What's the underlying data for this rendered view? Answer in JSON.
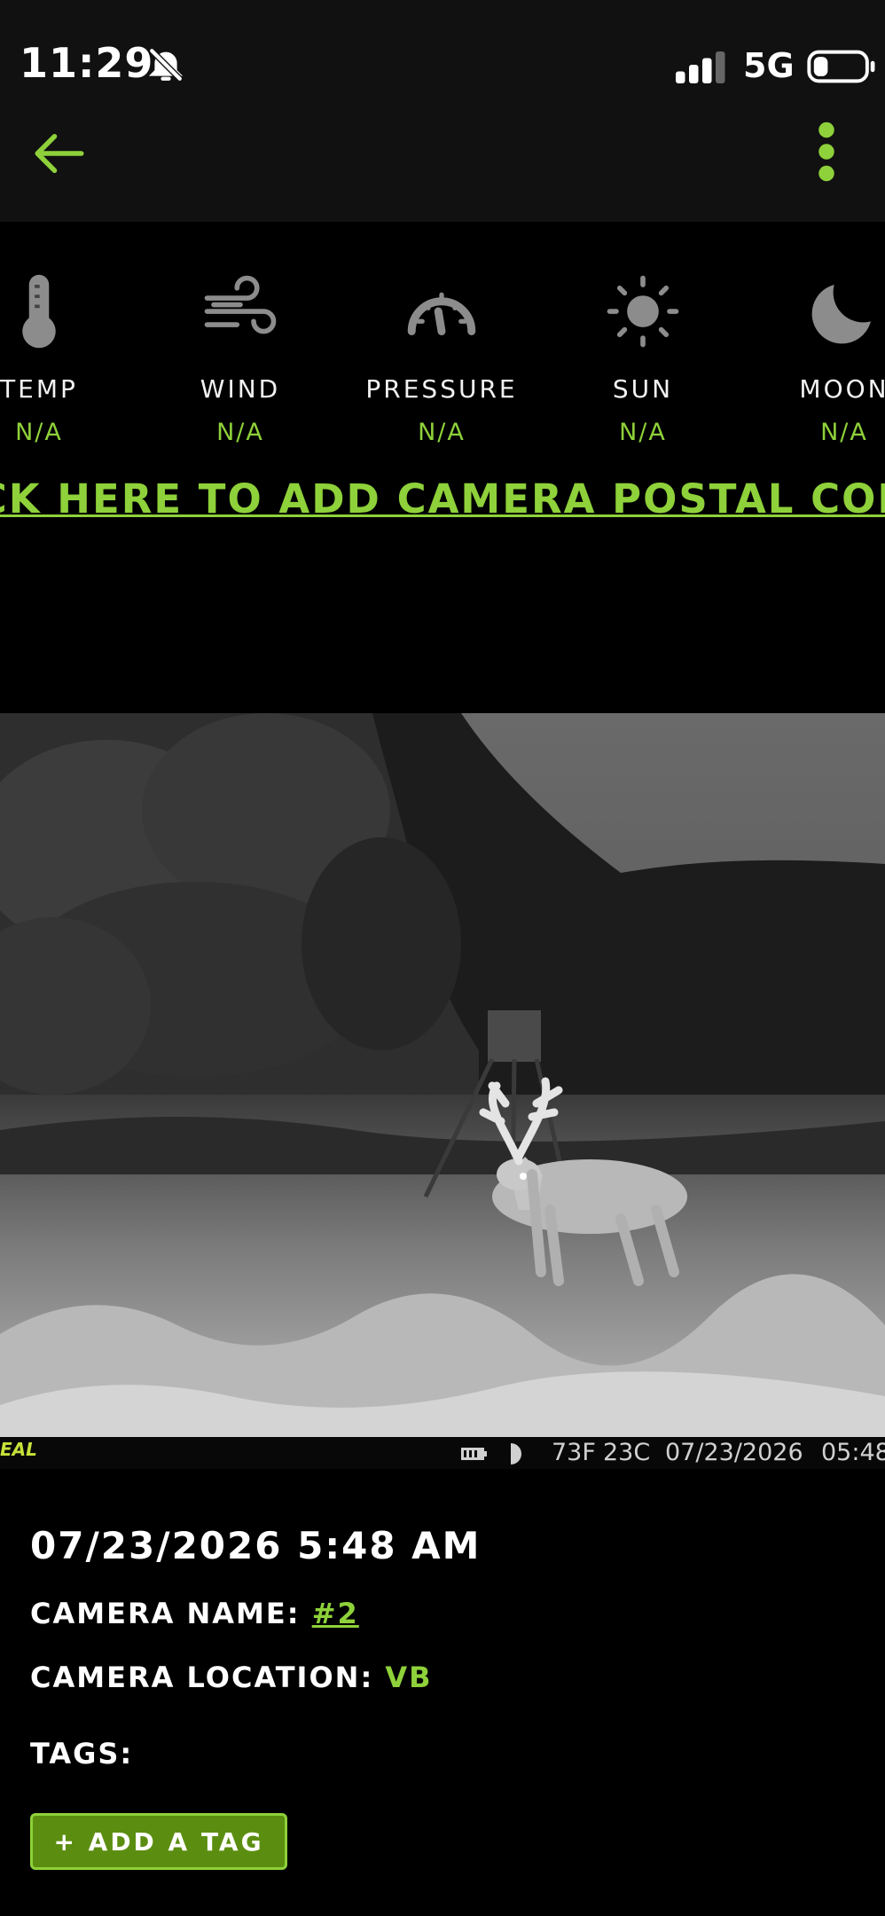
{
  "status_bar": {
    "time": "11:29",
    "network": "5G",
    "icons": [
      "bell-off-icon",
      "signal-icon",
      "battery-icon"
    ]
  },
  "app_bar": {
    "back_icon": "arrow-left-icon",
    "menu_icon": "more-vertical-icon",
    "accent_color": "#8ed13a"
  },
  "weather": [
    {
      "label": "TEMP",
      "value": "N/A",
      "icon": "thermometer-icon"
    },
    {
      "label": "WIND",
      "value": "N/A",
      "icon": "wind-icon"
    },
    {
      "label": "PRESSURE",
      "value": "N/A",
      "icon": "gauge-icon"
    },
    {
      "label": "SUN",
      "value": "N/A",
      "icon": "sun-icon"
    },
    {
      "label": "MOON",
      "value": "N/A",
      "icon": "moon-icon"
    }
  ],
  "postal_link": "ICK HERE TO ADD CAMERA POSTAL COD",
  "photo": {
    "brand": "EAL",
    "temp_f": "73F",
    "temp_c": "23C",
    "date": "07/23/2026",
    "time": "05:48"
  },
  "details": {
    "datetime": "07/23/2026 5:48 AM",
    "camera_name_label": "CAMERA NAME:",
    "camera_name_value": "#2",
    "camera_location_label": "CAMERA LOCATION:",
    "camera_location_value": "VB",
    "tags_label": "TAGS:",
    "add_tag_button": "+ ADD A TAG"
  }
}
